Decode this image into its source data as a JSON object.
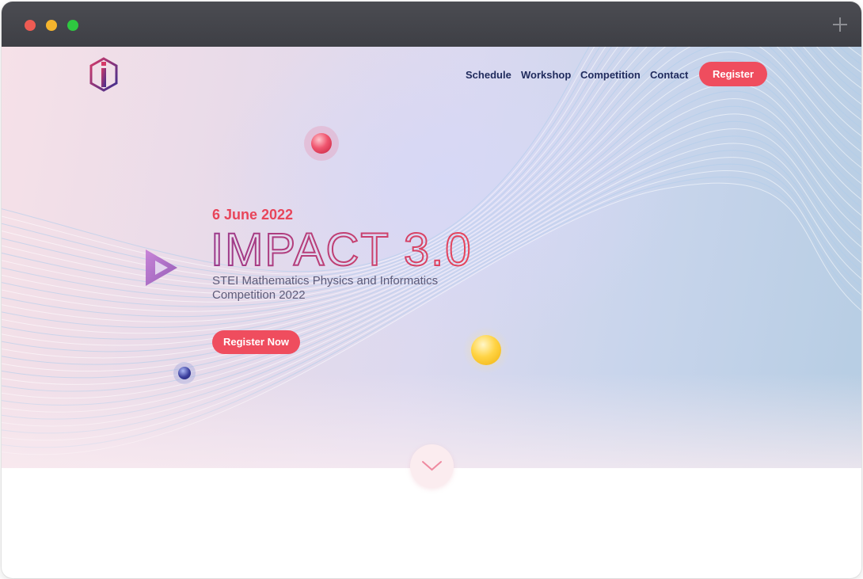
{
  "nav": {
    "items": [
      {
        "label": "Schedule"
      },
      {
        "label": "Workshop"
      },
      {
        "label": "Competition"
      },
      {
        "label": "Contact"
      }
    ],
    "register_label": "Register"
  },
  "hero": {
    "date": "6 June 2022",
    "title": "IMPACT 3.0",
    "subtitle": "STEI Mathematics Physics and Informatics Competition 2022",
    "cta_label": "Register Now"
  },
  "colors": {
    "accent": "#ef4d5e",
    "nav_text": "#1f2a5c",
    "title_gradient_start": "#9a3a8c",
    "title_gradient_end": "#e8455a"
  },
  "icons": {
    "logo": "impact-logo",
    "scroll": "chevron-down-icon",
    "window_add": "plus-icon"
  }
}
